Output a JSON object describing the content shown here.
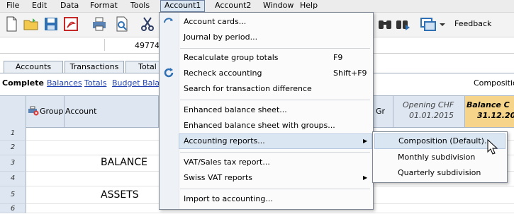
{
  "menubar": {
    "items": [
      "File",
      "Edit",
      "Data",
      "Format",
      "Tools",
      "Account1",
      "Account2",
      "Window",
      "Help"
    ],
    "active": "Account1"
  },
  "toolbar": {
    "feedback_label": "Feedback",
    "icons": [
      "new-file-icon",
      "open-folder-icon",
      "save-icon",
      "pdf-icon",
      "print-icon",
      "print-preview-icon",
      "cut-icon",
      "binoculars-icon",
      "find-replace-icon",
      "window-switch-icon"
    ]
  },
  "addressbar": {
    "value": "49774"
  },
  "tabs": [
    "Accounts",
    "Transactions",
    "Total"
  ],
  "views": {
    "current": "Complete",
    "links": [
      "Balances",
      "Totals",
      "Budget Balance"
    ],
    "right_label": "Composition"
  },
  "grid": {
    "headers": {
      "group": "Group",
      "account": "Account",
      "gr": "Gr",
      "opening_title": "Opening CHF",
      "opening_date": "01.01.2015",
      "balance_title": "Balance C",
      "balance_date": "31.12.20"
    },
    "rows": [
      {
        "num": "1",
        "text": ""
      },
      {
        "num": "2",
        "text": ""
      },
      {
        "num": "3",
        "text": "BALANCE"
      },
      {
        "num": "4",
        "text": ""
      },
      {
        "num": "5",
        "text": "ASSETS"
      },
      {
        "num": "6",
        "text": ""
      }
    ]
  },
  "account1_menu": {
    "items": [
      {
        "label": "Account cards...",
        "shortcut": "",
        "submenu": false
      },
      {
        "label": "Journal by period...",
        "shortcut": "",
        "submenu": false
      },
      {
        "label": "Recalculate group totals",
        "shortcut": "F9",
        "submenu": false
      },
      {
        "label": "Recheck accounting",
        "shortcut": "Shift+F9",
        "submenu": false
      },
      {
        "label": "Search for transaction difference",
        "shortcut": "",
        "submenu": false
      },
      {
        "label": "Enhanced balance sheet...",
        "shortcut": "",
        "submenu": false
      },
      {
        "label": "Enhanced balance sheet with groups...",
        "shortcut": "",
        "submenu": false
      },
      {
        "label": "Accounting reports...",
        "shortcut": "",
        "submenu": true
      },
      {
        "label": "VAT/Sales tax report...",
        "shortcut": "",
        "submenu": false
      },
      {
        "label": "Swiss VAT reports",
        "shortcut": "",
        "submenu": true
      },
      {
        "label": "Import to accounting...",
        "shortcut": "",
        "submenu": false
      }
    ]
  },
  "accounting_reports_submenu": {
    "items": [
      "Composition (Default)...",
      "Monthly subdivision",
      "Quarterly subdivision"
    ]
  },
  "colors": {
    "menu_highlight": "#dbe6f3",
    "header_bg": "#dde6f1",
    "balance_header_bg": "#f6d48a",
    "link": "#1f3fae"
  }
}
